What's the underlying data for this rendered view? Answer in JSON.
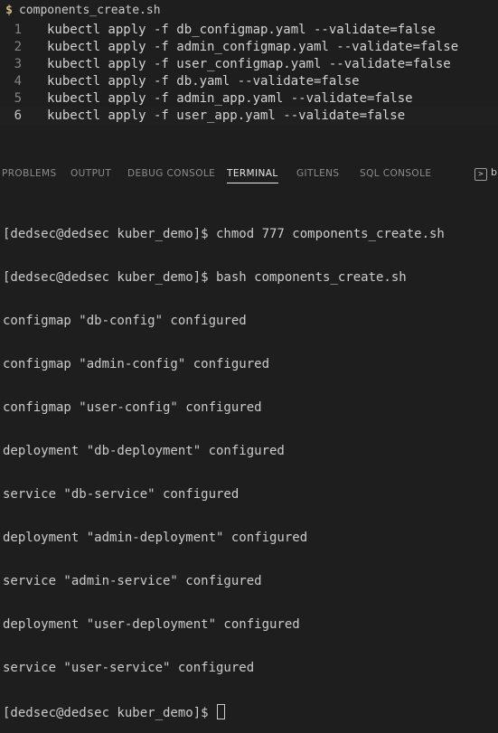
{
  "editor": {
    "breadcrumb_icon": "$",
    "filename": "components_create.sh",
    "lines": [
      {
        "number": "1",
        "text": "kubectl apply -f db_configmap.yaml --validate=false"
      },
      {
        "number": "2",
        "text": "kubectl apply -f admin_configmap.yaml --validate=false"
      },
      {
        "number": "3",
        "text": "kubectl apply -f user_configmap.yaml --validate=false"
      },
      {
        "number": "4",
        "text": "kubectl apply -f db.yaml --validate=false"
      },
      {
        "number": "5",
        "text": "kubectl apply -f admin_app.yaml --validate=false"
      },
      {
        "number": "6",
        "text": "kubectl apply -f user_app.yaml --validate=false"
      }
    ]
  },
  "panel": {
    "tabs": [
      {
        "label": "PROBLEMS"
      },
      {
        "label": "OUTPUT"
      },
      {
        "label": "DEBUG CONSOLE"
      },
      {
        "label": "TERMINAL"
      },
      {
        "label": "GITLENS"
      },
      {
        "label": "SQL CONSOLE"
      }
    ],
    "active_tab": "TERMINAL",
    "action_label": "b"
  },
  "terminal": {
    "lines": [
      "[dedsec@dedsec kuber_demo]$ chmod 777 components_create.sh",
      "[dedsec@dedsec kuber_demo]$ bash components_create.sh",
      "configmap \"db-config\" configured",
      "configmap \"admin-config\" configured",
      "configmap \"user-config\" configured",
      "deployment \"db-deployment\" configured",
      "service \"db-service\" configured",
      "deployment \"admin-deployment\" configured",
      "service \"admin-service\" configured",
      "deployment \"user-deployment\" configured",
      "service \"user-service\" configured"
    ],
    "prompt": "[dedsec@dedsec kuber_demo]$ "
  }
}
